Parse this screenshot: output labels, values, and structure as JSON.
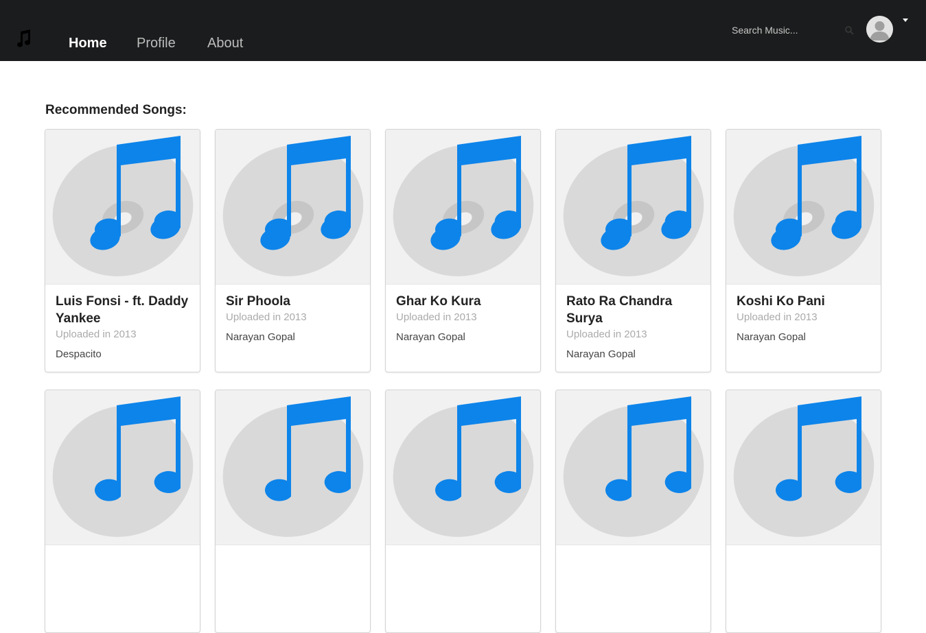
{
  "nav": {
    "items": [
      {
        "label": "Home",
        "active": true
      },
      {
        "label": "Profile",
        "active": false
      },
      {
        "label": "About",
        "active": false
      }
    ],
    "search_placeholder": "Search Music..."
  },
  "section_title": "Recommended Songs:",
  "songs": [
    {
      "title": "Luis Fonsi - ft. Daddy Yankee",
      "uploaded": "Uploaded in 2013",
      "description": "Despacito"
    },
    {
      "title": "Sir Phoola",
      "uploaded": "Uploaded in 2013",
      "description": "Narayan Gopal"
    },
    {
      "title": "Ghar Ko Kura",
      "uploaded": "Uploaded in 2013",
      "description": "Narayan Gopal"
    },
    {
      "title": "Rato Ra Chandra Surya",
      "uploaded": "Uploaded in 2013",
      "description": "Narayan Gopal"
    },
    {
      "title": "Koshi Ko Pani",
      "uploaded": "Uploaded in 2013",
      "description": "Narayan Gopal"
    }
  ],
  "colors": {
    "navbar": "#1b1c1d",
    "note": "#0d84ea",
    "disc": "#d9d9d9",
    "art_bg": "#f1f1f1"
  },
  "icons": {
    "logo": "music-note-icon",
    "search": "search-icon",
    "avatar": "user-avatar-icon",
    "caret": "caret-down-icon",
    "art": "music-disc-icon"
  }
}
